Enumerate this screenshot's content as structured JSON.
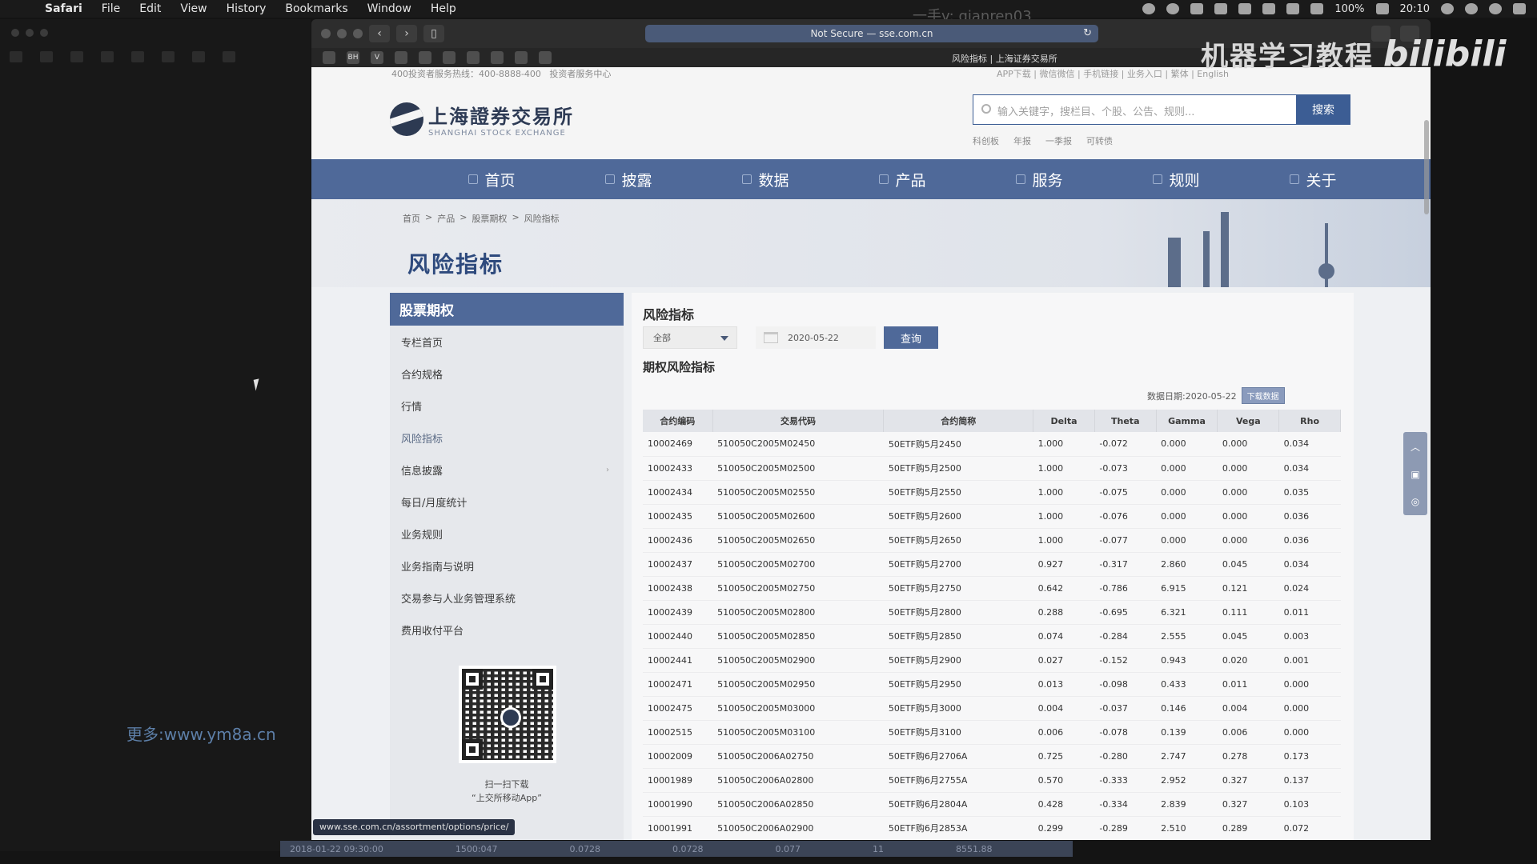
{
  "menubar": {
    "app": "Safari",
    "items": [
      "File",
      "Edit",
      "View",
      "History",
      "Bookmarks",
      "Window",
      "Help"
    ],
    "battery": "100%",
    "time": "20:10"
  },
  "overlays": {
    "top_watermark": "一手v: qianren03",
    "brand": "机器学习教程",
    "bilibili": "bilibili",
    "side_link": "更多:www.ym8a.cn"
  },
  "browser": {
    "address": "Not Secure — sse.com.cn",
    "tab_title": "风险指标 | 上海证券交易所",
    "status_url": "www.sse.com.cn/assortment/options/price/"
  },
  "header": {
    "hotline": "400投资者服务热线：400-8888-400",
    "investor_center": "投资者服务中心",
    "top_links": "APP下载  |  微信微信  |  手机链接  |  业务入口  |  繁体  |  English",
    "logo_cn": "上海證券交易所",
    "logo_en": "SHANGHAI STOCK EXCHANGE",
    "search_placeholder": "输入关键字，搜栏目、个股、公告、规则...",
    "search_button": "搜索",
    "hot_terms": [
      "科创板",
      "年报",
      "一季报",
      "可转债"
    ]
  },
  "nav": [
    "首页",
    "披露",
    "数据",
    "产品",
    "服务",
    "规则",
    "关于"
  ],
  "breadcrumb": [
    "首页",
    "产品",
    "股票期权",
    "风险指标"
  ],
  "page_title": "风险指标",
  "sidebar": {
    "header": "股票期权",
    "items": [
      "专栏首页",
      "合约规格",
      "行情",
      "风险指标",
      "信息披露",
      "每日/月度统计",
      "业务规则",
      "业务指南与说明",
      "交易参与人业务管理系统",
      "费用收付平台"
    ],
    "qr_caption_1": "扫一扫下载",
    "qr_caption_2": "“上交所移动App”"
  },
  "main": {
    "title": "风险指标",
    "select_value": "全部",
    "date_value": "2020-05-22",
    "query_button": "查询",
    "subtitle": "期权风险指标",
    "data_date": "数据日期:2020-05-22",
    "download_button": "下载数据",
    "columns": [
      "合约编码",
      "交易代码",
      "合约简称",
      "Delta",
      "Theta",
      "Gamma",
      "Vega",
      "Rho"
    ],
    "rows": [
      [
        "10002469",
        "510050C2005M02450",
        "50ETF购5月2450",
        "1.000",
        "-0.072",
        "0.000",
        "0.000",
        "0.034"
      ],
      [
        "10002433",
        "510050C2005M02500",
        "50ETF购5月2500",
        "1.000",
        "-0.073",
        "0.000",
        "0.000",
        "0.034"
      ],
      [
        "10002434",
        "510050C2005M02550",
        "50ETF购5月2550",
        "1.000",
        "-0.075",
        "0.000",
        "0.000",
        "0.035"
      ],
      [
        "10002435",
        "510050C2005M02600",
        "50ETF购5月2600",
        "1.000",
        "-0.076",
        "0.000",
        "0.000",
        "0.036"
      ],
      [
        "10002436",
        "510050C2005M02650",
        "50ETF购5月2650",
        "1.000",
        "-0.077",
        "0.000",
        "0.000",
        "0.036"
      ],
      [
        "10002437",
        "510050C2005M02700",
        "50ETF购5月2700",
        "0.927",
        "-0.317",
        "2.860",
        "0.045",
        "0.034"
      ],
      [
        "10002438",
        "510050C2005M02750",
        "50ETF购5月2750",
        "0.642",
        "-0.786",
        "6.915",
        "0.121",
        "0.024"
      ],
      [
        "10002439",
        "510050C2005M02800",
        "50ETF购5月2800",
        "0.288",
        "-0.695",
        "6.321",
        "0.111",
        "0.011"
      ],
      [
        "10002440",
        "510050C2005M02850",
        "50ETF购5月2850",
        "0.074",
        "-0.284",
        "2.555",
        "0.045",
        "0.003"
      ],
      [
        "10002441",
        "510050C2005M02900",
        "50ETF购5月2900",
        "0.027",
        "-0.152",
        "0.943",
        "0.020",
        "0.001"
      ],
      [
        "10002471",
        "510050C2005M02950",
        "50ETF购5月2950",
        "0.013",
        "-0.098",
        "0.433",
        "0.011",
        "0.000"
      ],
      [
        "10002475",
        "510050C2005M03000",
        "50ETF购5月3000",
        "0.004",
        "-0.037",
        "0.146",
        "0.004",
        "0.000"
      ],
      [
        "10002515",
        "510050C2005M03100",
        "50ETF购5月3100",
        "0.006",
        "-0.078",
        "0.139",
        "0.006",
        "0.000"
      ],
      [
        "10002009",
        "510050C2006A02750",
        "50ETF购6月2706A",
        "0.725",
        "-0.280",
        "2.747",
        "0.278",
        "0.173"
      ],
      [
        "10001989",
        "510050C2006A02800",
        "50ETF购6月2755A",
        "0.570",
        "-0.333",
        "2.952",
        "0.327",
        "0.137"
      ],
      [
        "10001990",
        "510050C2006A02850",
        "50ETF购6月2804A",
        "0.428",
        "-0.334",
        "2.839",
        "0.327",
        "0.103"
      ],
      [
        "10001991",
        "510050C2006A02900",
        "50ETF购6月2853A",
        "0.299",
        "-0.289",
        "2.510",
        "0.289",
        "0.072"
      ]
    ]
  },
  "bottom_strip": [
    "2018-01-22 09:30:00",
    "1500:047",
    "0.0728",
    "0.0728",
    "0.077",
    "11",
    "8551.88"
  ],
  "colors": {
    "nav_blue": "#4f6999",
    "search_border": "#3c5d94",
    "address_bar": "#4a5a78"
  }
}
